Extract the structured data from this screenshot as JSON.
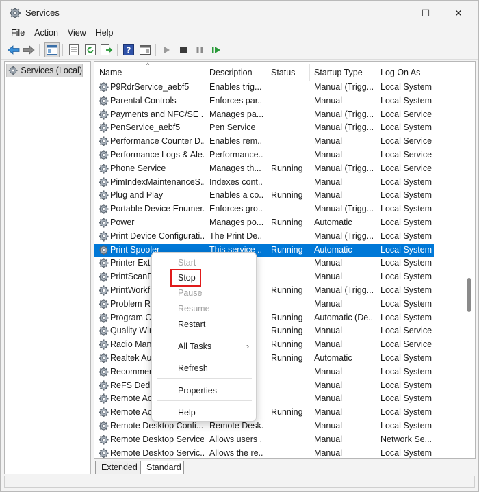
{
  "window": {
    "title": "Services",
    "controls": {
      "minimize": "—",
      "maximize": "☐",
      "close": "✕"
    }
  },
  "menu": [
    "File",
    "Action",
    "View",
    "Help"
  ],
  "tree": {
    "root_label": "Services (Local)"
  },
  "columns": [
    "Name",
    "Description",
    "Status",
    "Startup Type",
    "Log On As"
  ],
  "services": [
    {
      "name": "P9RdrService_aebf5",
      "description": "Enables trig...",
      "status": "",
      "startup": "Manual (Trigg...",
      "logon": "Local System"
    },
    {
      "name": "Parental Controls",
      "description": "Enforces par...",
      "status": "",
      "startup": "Manual",
      "logon": "Local System"
    },
    {
      "name": "Payments and NFC/SE ...",
      "description": "Manages pa...",
      "status": "",
      "startup": "Manual (Trigg...",
      "logon": "Local Service"
    },
    {
      "name": "PenService_aebf5",
      "description": "Pen Service",
      "status": "",
      "startup": "Manual (Trigg...",
      "logon": "Local System"
    },
    {
      "name": "Performance Counter D...",
      "description": "Enables rem...",
      "status": "",
      "startup": "Manual",
      "logon": "Local Service"
    },
    {
      "name": "Performance Logs & Ale...",
      "description": "Performance...",
      "status": "",
      "startup": "Manual",
      "logon": "Local Service"
    },
    {
      "name": "Phone Service",
      "description": "Manages th...",
      "status": "Running",
      "startup": "Manual (Trigg...",
      "logon": "Local Service"
    },
    {
      "name": "PimIndexMaintenanceS...",
      "description": "Indexes cont...",
      "status": "",
      "startup": "Manual",
      "logon": "Local System"
    },
    {
      "name": "Plug and Play",
      "description": "Enables a co...",
      "status": "Running",
      "startup": "Manual",
      "logon": "Local System"
    },
    {
      "name": "Portable Device Enumer...",
      "description": "Enforces gro...",
      "status": "",
      "startup": "Manual (Trigg...",
      "logon": "Local System"
    },
    {
      "name": "Power",
      "description": "Manages po...",
      "status": "Running",
      "startup": "Automatic",
      "logon": "Local System"
    },
    {
      "name": "Print Device Configurati...",
      "description": "The Print De...",
      "status": "",
      "startup": "Manual (Trigg...",
      "logon": "Local System"
    },
    {
      "name": "Print Spooler",
      "description": "This service ...",
      "status": "Running",
      "startup": "Automatic",
      "logon": "Local System"
    },
    {
      "name": "Printer Exte",
      "description": "",
      "status": "",
      "startup": "Manual",
      "logon": "Local System"
    },
    {
      "name": "PrintScanBr",
      "description": "",
      "status": "",
      "startup": "Manual",
      "logon": "Local System"
    },
    {
      "name": "PrintWorkf",
      "description": "",
      "status": "Running",
      "startup": "Manual (Trigg...",
      "logon": "Local System"
    },
    {
      "name": "Problem Re",
      "description": "",
      "status": "",
      "startup": "Manual",
      "logon": "Local System"
    },
    {
      "name": "Program Co",
      "description": "",
      "status": "Running",
      "startup": "Automatic (De...",
      "logon": "Local System"
    },
    {
      "name": "Quality Wir",
      "description": "",
      "status": "Running",
      "startup": "Manual",
      "logon": "Local Service"
    },
    {
      "name": "Radio Man",
      "description": "",
      "status": "Running",
      "startup": "Manual",
      "logon": "Local Service"
    },
    {
      "name": "Realtek Auc",
      "description": "",
      "status": "Running",
      "startup": "Automatic",
      "logon": "Local System"
    },
    {
      "name": "Recommen",
      "description": "",
      "status": "",
      "startup": "Manual",
      "logon": "Local System"
    },
    {
      "name": "ReFS Dedu",
      "description": "",
      "status": "",
      "startup": "Manual",
      "logon": "Local System"
    },
    {
      "name": "Remote Acc",
      "description": "",
      "status": "",
      "startup": "Manual",
      "logon": "Local System"
    },
    {
      "name": "Remote Acc",
      "description": "",
      "status": "Running",
      "startup": "Manual",
      "logon": "Local System"
    },
    {
      "name": "Remote Desktop Confi...",
      "description": "Remote Desk...",
      "status": "",
      "startup": "Manual",
      "logon": "Local System"
    },
    {
      "name": "Remote Desktop Services",
      "description": "Allows users ...",
      "status": "",
      "startup": "Manual",
      "logon": "Network Se..."
    },
    {
      "name": "Remote Desktop Servic...",
      "description": "Allows the re...",
      "status": "",
      "startup": "Manual",
      "logon": "Local System"
    }
  ],
  "selected_index": 12,
  "context_menu": {
    "start": "Start",
    "stop": "Stop",
    "pause": "Pause",
    "resume": "Resume",
    "restart": "Restart",
    "all_tasks": "All Tasks",
    "refresh": "Refresh",
    "properties": "Properties",
    "help": "Help",
    "submenu_arrow": "›"
  },
  "tabs": {
    "extended": "Extended",
    "standard": "Standard"
  },
  "colors": {
    "selection": "#0078d7",
    "highlight_box": "#e01b1b"
  }
}
